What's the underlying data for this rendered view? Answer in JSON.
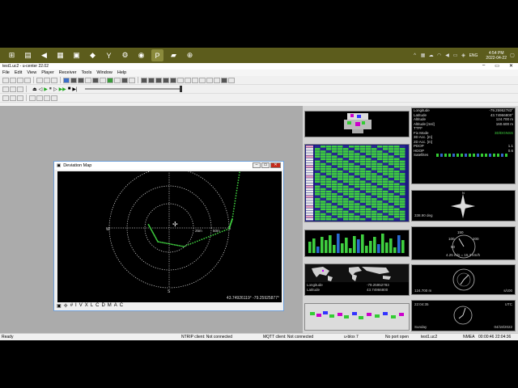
{
  "taskbar": {
    "apps": [
      {
        "name": "file-explorer-icon",
        "glyph": "▤"
      },
      {
        "name": "vscode-icon",
        "glyph": "◀"
      },
      {
        "name": "notepad-icon",
        "glyph": "▦"
      },
      {
        "name": "terminal-icon",
        "glyph": "▣"
      },
      {
        "name": "visual-studio-icon",
        "glyph": "◆"
      },
      {
        "name": "yahoo-icon",
        "glyph": "Y"
      },
      {
        "name": "settings-icon",
        "glyph": "⚙"
      },
      {
        "name": "chrome-icon",
        "glyph": "◉"
      },
      {
        "name": "p-app-icon",
        "glyph": "P"
      },
      {
        "name": "notes-icon",
        "glyph": "▰"
      },
      {
        "name": "ucenter-icon",
        "glyph": "⊕"
      }
    ],
    "language": "ENG",
    "time": "4:54 PM",
    "date": "2022-04-22"
  },
  "window": {
    "title": "test1.uc2 - u-center 22.02"
  },
  "menu": [
    "File",
    "Edit",
    "View",
    "Player",
    "Receiver",
    "Tools",
    "Window",
    "Help"
  ],
  "deviation_map": {
    "title": "Deviation Map",
    "compass": {
      "n": "N",
      "s": "S",
      "e": "E",
      "w": "W"
    },
    "ring_labels": [
      "25m",
      "50m"
    ],
    "coordinates": "43.74926119° -79.25925877°",
    "toolbar_letters": [
      "I",
      "V",
      "X",
      "L",
      "C",
      "D",
      "M",
      "A",
      "C"
    ]
  },
  "nav_table": {
    "rows": [
      {
        "label": "Longitude",
        "value": "-79.25952783°",
        "green": false
      },
      {
        "label": "Latitude",
        "value": "43.74966800°",
        "green": false
      },
      {
        "label": "Altitude",
        "value": "124.700 m",
        "green": false
      },
      {
        "label": "Altitude [msl]",
        "value": "160.600 m",
        "green": false
      },
      {
        "label": "TTFF",
        "value": "",
        "green": false
      },
      {
        "label": "Fix Mode",
        "value": "3D/DGNSS",
        "green": true
      },
      {
        "label": "3D Acc. [m]",
        "value": "",
        "green": false
      },
      {
        "label": "2D Acc. [m]",
        "value": "",
        "green": false
      },
      {
        "label": "PDOP",
        "value": "1.1",
        "green": false
      },
      {
        "label": "HDOP",
        "value": "0.6",
        "green": false
      },
      {
        "label": "Satellites",
        "value": "",
        "green": false
      }
    ]
  },
  "panels": {
    "world": {
      "longitude_label": "Longitude",
      "longitude": "-79.25952783",
      "latitude_label": "Latitude",
      "latitude": "43.74966800"
    },
    "compass_heading": "338.90 deg",
    "speed": "4.25 m/s = 15.3 km/h",
    "speed_ticks": [
      "150",
      "100",
      "200",
      "50"
    ],
    "altitude": "124.700 m",
    "time_left": "22:04:35",
    "time_right": "UTC",
    "day": "Sunday",
    "date": "04/18/2022",
    "clock_right": "s/c00"
  },
  "statusbar": {
    "ready": "Ready",
    "ntrip": "NTRIP client: Not connected",
    "mqtt": "MQTT client: Not connected",
    "ublox": "u-blox 7",
    "port": "No port open",
    "file": "test1.uc2",
    "nmea": "NMEA",
    "timer": "00:00:46  22:04:36"
  },
  "colors": {
    "taskbar": "#5c5c1c",
    "track": "#3fcf3f",
    "nav_green": "#3fcf3f"
  }
}
